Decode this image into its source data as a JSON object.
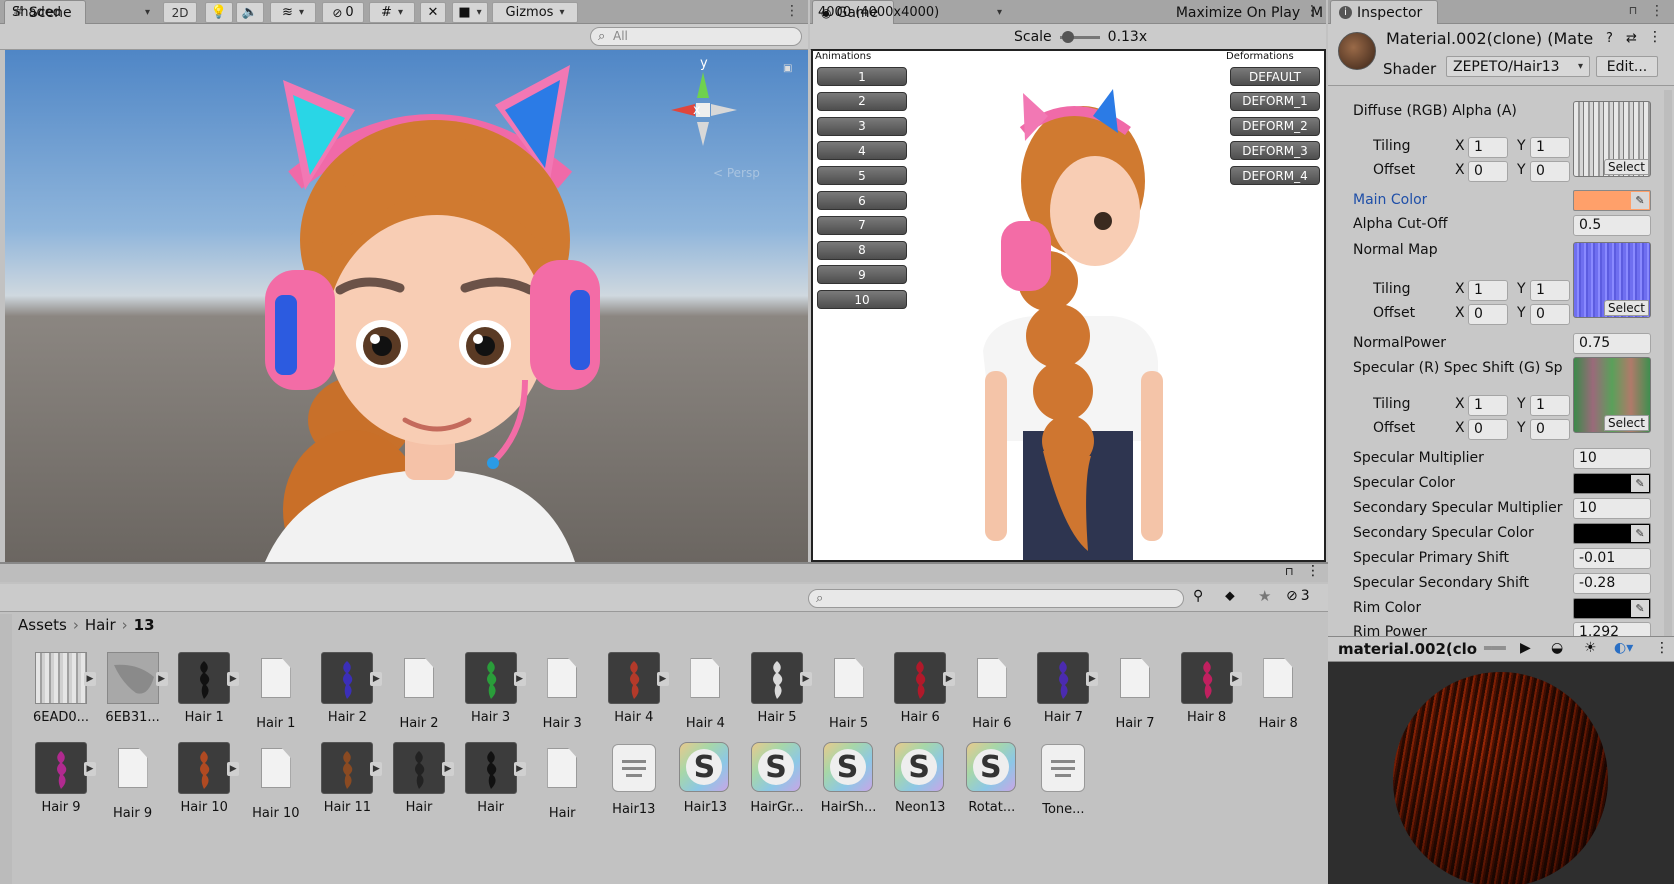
{
  "scene": {
    "tab": "Scene",
    "shading": "Shaded",
    "btn_2d": "2D",
    "hidden_count": "0",
    "gizmos": "Gizmos",
    "search_placeholder": "All",
    "axis_x": "x",
    "axis_y": "y",
    "persp": "< Persp"
  },
  "game": {
    "tab": "Game",
    "resolution": "4000 (4000x4000)",
    "scale_label": "Scale",
    "scale_value": "0.13x",
    "maximize": "Maximize On Play",
    "more": "M",
    "animations_label": "Animations",
    "deformations_label": "Deformations",
    "animations": [
      "1",
      "2",
      "3",
      "4",
      "5",
      "6",
      "7",
      "8",
      "9",
      "10"
    ],
    "deformations": [
      "DEFAULT",
      "DEFORM_1",
      "DEFORM_2",
      "DEFORM_3",
      "DEFORM_4"
    ]
  },
  "inspector": {
    "tab": "Inspector",
    "material_name": "Material.002(clone) (Mate",
    "shader_label": "Shader",
    "shader_value": "ZEPETO/Hair13",
    "edit_btn": "Edit...",
    "diffuse": "Diffuse (RGB) Alpha (A)",
    "tiling": "Tiling",
    "offset": "Offset",
    "x": "X",
    "y": "Y",
    "select": "Select",
    "main_color": "Main Color",
    "alpha_cutoff": "Alpha Cut-Off",
    "alpha_cutoff_value": "0.5",
    "normal_map": "Normal Map",
    "normal_power": "NormalPower",
    "normal_power_value": "0.75",
    "specular_tex": "Specular (R) Spec Shift (G) Sp",
    "spec_mult": "Specular Multiplier",
    "spec_mult_value": "10",
    "spec_color": "Specular Color",
    "sec_spec_mult": "Secondary Specular Multiplier",
    "sec_spec_mult_value": "10",
    "sec_spec_color": "Secondary Specular Color",
    "spec_primary_shift": "Specular Primary Shift",
    "spec_primary_shift_value": "-0.01",
    "spec_secondary_shift": "Specular Secondary Shift",
    "spec_secondary_shift_value": "-0.28",
    "rim_color": "Rim Color",
    "rim_power": "Rim Power",
    "rim_power_value": "1.292",
    "tiling_values": {
      "x": "1",
      "y": "1"
    },
    "offset_values": {
      "x": "0",
      "y": "0"
    },
    "preview_title": "material.002(clone"
  },
  "project": {
    "breadcrumb": [
      "Assets",
      "Hair",
      "13"
    ],
    "hidden_count": "3",
    "assets_row1": [
      {
        "label": "6EAD0...",
        "kind": "texture"
      },
      {
        "label": "6EB31...",
        "kind": "mesh"
      },
      {
        "label": "Hair 1",
        "kind": "prefab",
        "color": "#111111"
      },
      {
        "label": "Hair 1",
        "kind": "doc"
      },
      {
        "label": "Hair 2",
        "kind": "prefab",
        "color": "#3b2fb8"
      },
      {
        "label": "Hair 2",
        "kind": "doc"
      },
      {
        "label": "Hair 3",
        "kind": "prefab",
        "color": "#2a9d3a"
      },
      {
        "label": "Hair 3",
        "kind": "doc"
      },
      {
        "label": "Hair 4",
        "kind": "prefab",
        "color": "#b33a2a"
      },
      {
        "label": "Hair 4",
        "kind": "doc"
      },
      {
        "label": "Hair 5",
        "kind": "prefab",
        "color": "#d9d9d9"
      },
      {
        "label": "Hair 5",
        "kind": "doc"
      },
      {
        "label": "Hair 6",
        "kind": "prefab",
        "color": "#b0192a"
      },
      {
        "label": "Hair 6",
        "kind": "doc"
      },
      {
        "label": "Hair 7",
        "kind": "prefab",
        "color": "#4b2bb0"
      },
      {
        "label": "Hair 7",
        "kind": "doc"
      },
      {
        "label": "Hair 8",
        "kind": "prefab",
        "color": "#c0205f"
      },
      {
        "label": "Hair 8",
        "kind": "doc"
      }
    ],
    "assets_row2": [
      {
        "label": "Hair 9",
        "kind": "prefab",
        "color": "#b02a8f"
      },
      {
        "label": "Hair 9",
        "kind": "doc"
      },
      {
        "label": "Hair 10",
        "kind": "prefab",
        "color": "#b04a22"
      },
      {
        "label": "Hair 10",
        "kind": "doc"
      },
      {
        "label": "Hair 11",
        "kind": "prefab",
        "color": "#8a4a22"
      },
      {
        "label": "Hair",
        "kind": "prefab",
        "color": "#222222"
      },
      {
        "label": "Hair",
        "kind": "prefab",
        "color": "#111111"
      },
      {
        "label": "Hair",
        "kind": "doc"
      },
      {
        "label": "Hair13",
        "kind": "text"
      },
      {
        "label": "Hair13",
        "kind": "shader"
      },
      {
        "label": "HairGr...",
        "kind": "shader"
      },
      {
        "label": "HairSh...",
        "kind": "shader"
      },
      {
        "label": "Neon13",
        "kind": "shader"
      },
      {
        "label": "Rotat...",
        "kind": "shader"
      },
      {
        "label": "Tone...",
        "kind": "text"
      }
    ]
  },
  "colors": {
    "main_color": "#ffa06a",
    "spec_color": "#000000",
    "rim_color": "#000000"
  }
}
